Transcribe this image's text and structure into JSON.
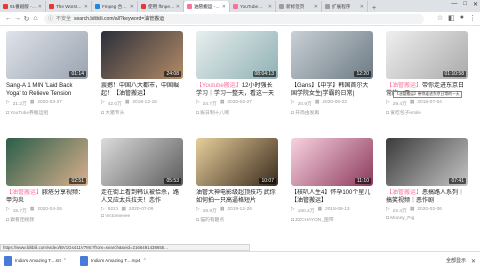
{
  "tabs": [
    {
      "label": "91番剧版 - YouTu",
      "color": "#e53935"
    },
    {
      "label": "The Worst Thing",
      "color": "#e53935"
    },
    {
      "label": "Fmpeg 合集 - 知",
      "color": "#1e88e5"
    },
    {
      "label": "使用 ffmpeg 在Li",
      "color": "#e53935"
    },
    {
      "label": "油管搬运 - 搜索结",
      "color": "#fb7299",
      "active": true
    },
    {
      "label": "YouTube不限下",
      "color": "#fb7299"
    },
    {
      "label": "新标签页",
      "color": "#9e9e9e"
    },
    {
      "label": "扩展程序",
      "color": "#9e9e9e"
    }
  ],
  "window_controls": [
    "—",
    "□",
    "✕"
  ],
  "address": {
    "security": "不安全",
    "url": "search.bilibili.com/all?keyword=油管搬运"
  },
  "videos": [
    {
      "tag": "",
      "title": "Sang-A 1 MIN 'Laid Back Yoga' to Relieve Tension",
      "views": "21.2万",
      "danmaku": "",
      "date": "2020-03-27",
      "author": "YouTube券搬运组",
      "duration": "01:14",
      "c1": "#dfe3ea",
      "c2": "#9aa3b0"
    },
    {
      "tag": "",
      "title": "震撼！中国八大都市，中国崛起！【油管搬运】",
      "views": "42.0万",
      "danmaku": "",
      "date": "2018-12-16",
      "author": "大猪专头",
      "duration": "24:08",
      "c1": "#2b2f3a",
      "c2": "#b38b67"
    },
    {
      "tag": "【Youtube搬运】",
      "title": "12小时强长学习｜学习一整天，看这一天",
      "views": "24.7万",
      "danmaku": "",
      "date": "2020-02-27",
      "author": "账日制十八啊",
      "duration": "08:04:13",
      "c1": "#e8eeee",
      "c2": "#8fb1b4"
    },
    {
      "tag": "",
      "title": "【Gans】【中字】韩国首尔大国学院女生|学霸的日常|",
      "views": "20.9万",
      "danmaku": "",
      "date": "2020-05-22",
      "author": "开简由发再",
      "duration": "12:20",
      "c1": "#c9d0d6",
      "c2": "#6d7b84"
    },
    {
      "tag": "【油管搬运】",
      "title": "带你走进东京日常的一天",
      "views": "29.4万",
      "danmaku": "",
      "date": "2018-07-04",
      "author": "爱吃包子emile",
      "duration": "01:10:58",
      "c1": "#efefef",
      "c2": "#aaaaaa"
    },
    {
      "tag": "【油管搬运】",
      "title": "脓疮分享视频：甲沟炎",
      "views": "15.7万",
      "danmaku": "",
      "date": "2020-04-26",
      "author": "察看团视频",
      "duration": "02:51",
      "c1": "#2b5d4a",
      "c2": "#d9b08c"
    },
    {
      "tag": "",
      "title": "走在街上看到韩认被恰杀，路人又应太兵拉夫！恋作",
      "views": "9221",
      "danmaku": "",
      "date": "2020-07-09",
      "author": "Victoriieeee",
      "duration": "05:53",
      "c1": "#dcdcdc",
      "c2": "#5b5b5b"
    },
    {
      "tag": "",
      "title": "油管大神电影级超顶技巧 武你如何拍一只高逼格短片",
      "views": "28.9万",
      "danmaku": "",
      "date": "2019-12-26",
      "author": "猫的有趣点",
      "duration": "10:07",
      "c1": "#e7cf9c",
      "c2": "#3a2a1c"
    },
    {
      "tag": "",
      "title": "【核叭人生4】怀孕100个星儿【油管搬运】",
      "views": "150.2万",
      "danmaku": "",
      "date": "2018-08-13",
      "author": "ZZCHAYON_国带",
      "duration": "11:10",
      "c1": "#f8d2e0",
      "c2": "#8c3a5c"
    },
    {
      "tag": "【油管搬运】",
      "title": "恶搞路人系列｜搞笑视频｜恶作剧",
      "views": "22.4万",
      "danmaku": "",
      "date": "2020-02-06",
      "author": "Money_Pig",
      "duration": "07:41",
      "c1": "#3b3b3b",
      "c2": "#c5c5c5"
    }
  ],
  "tooltip": "【油管搬运】带你走进东京日常的一天",
  "status_url": "https://www.bilibili.com/video/BV1Gs411V7Mc?from=search&seid=2166491438655...",
  "downloads": [
    {
      "name": "India's Amazing T....srt",
      "sub": ""
    },
    {
      "name": "India's Amazing T....mp4",
      "sub": ""
    }
  ],
  "show_all": "全部显示"
}
